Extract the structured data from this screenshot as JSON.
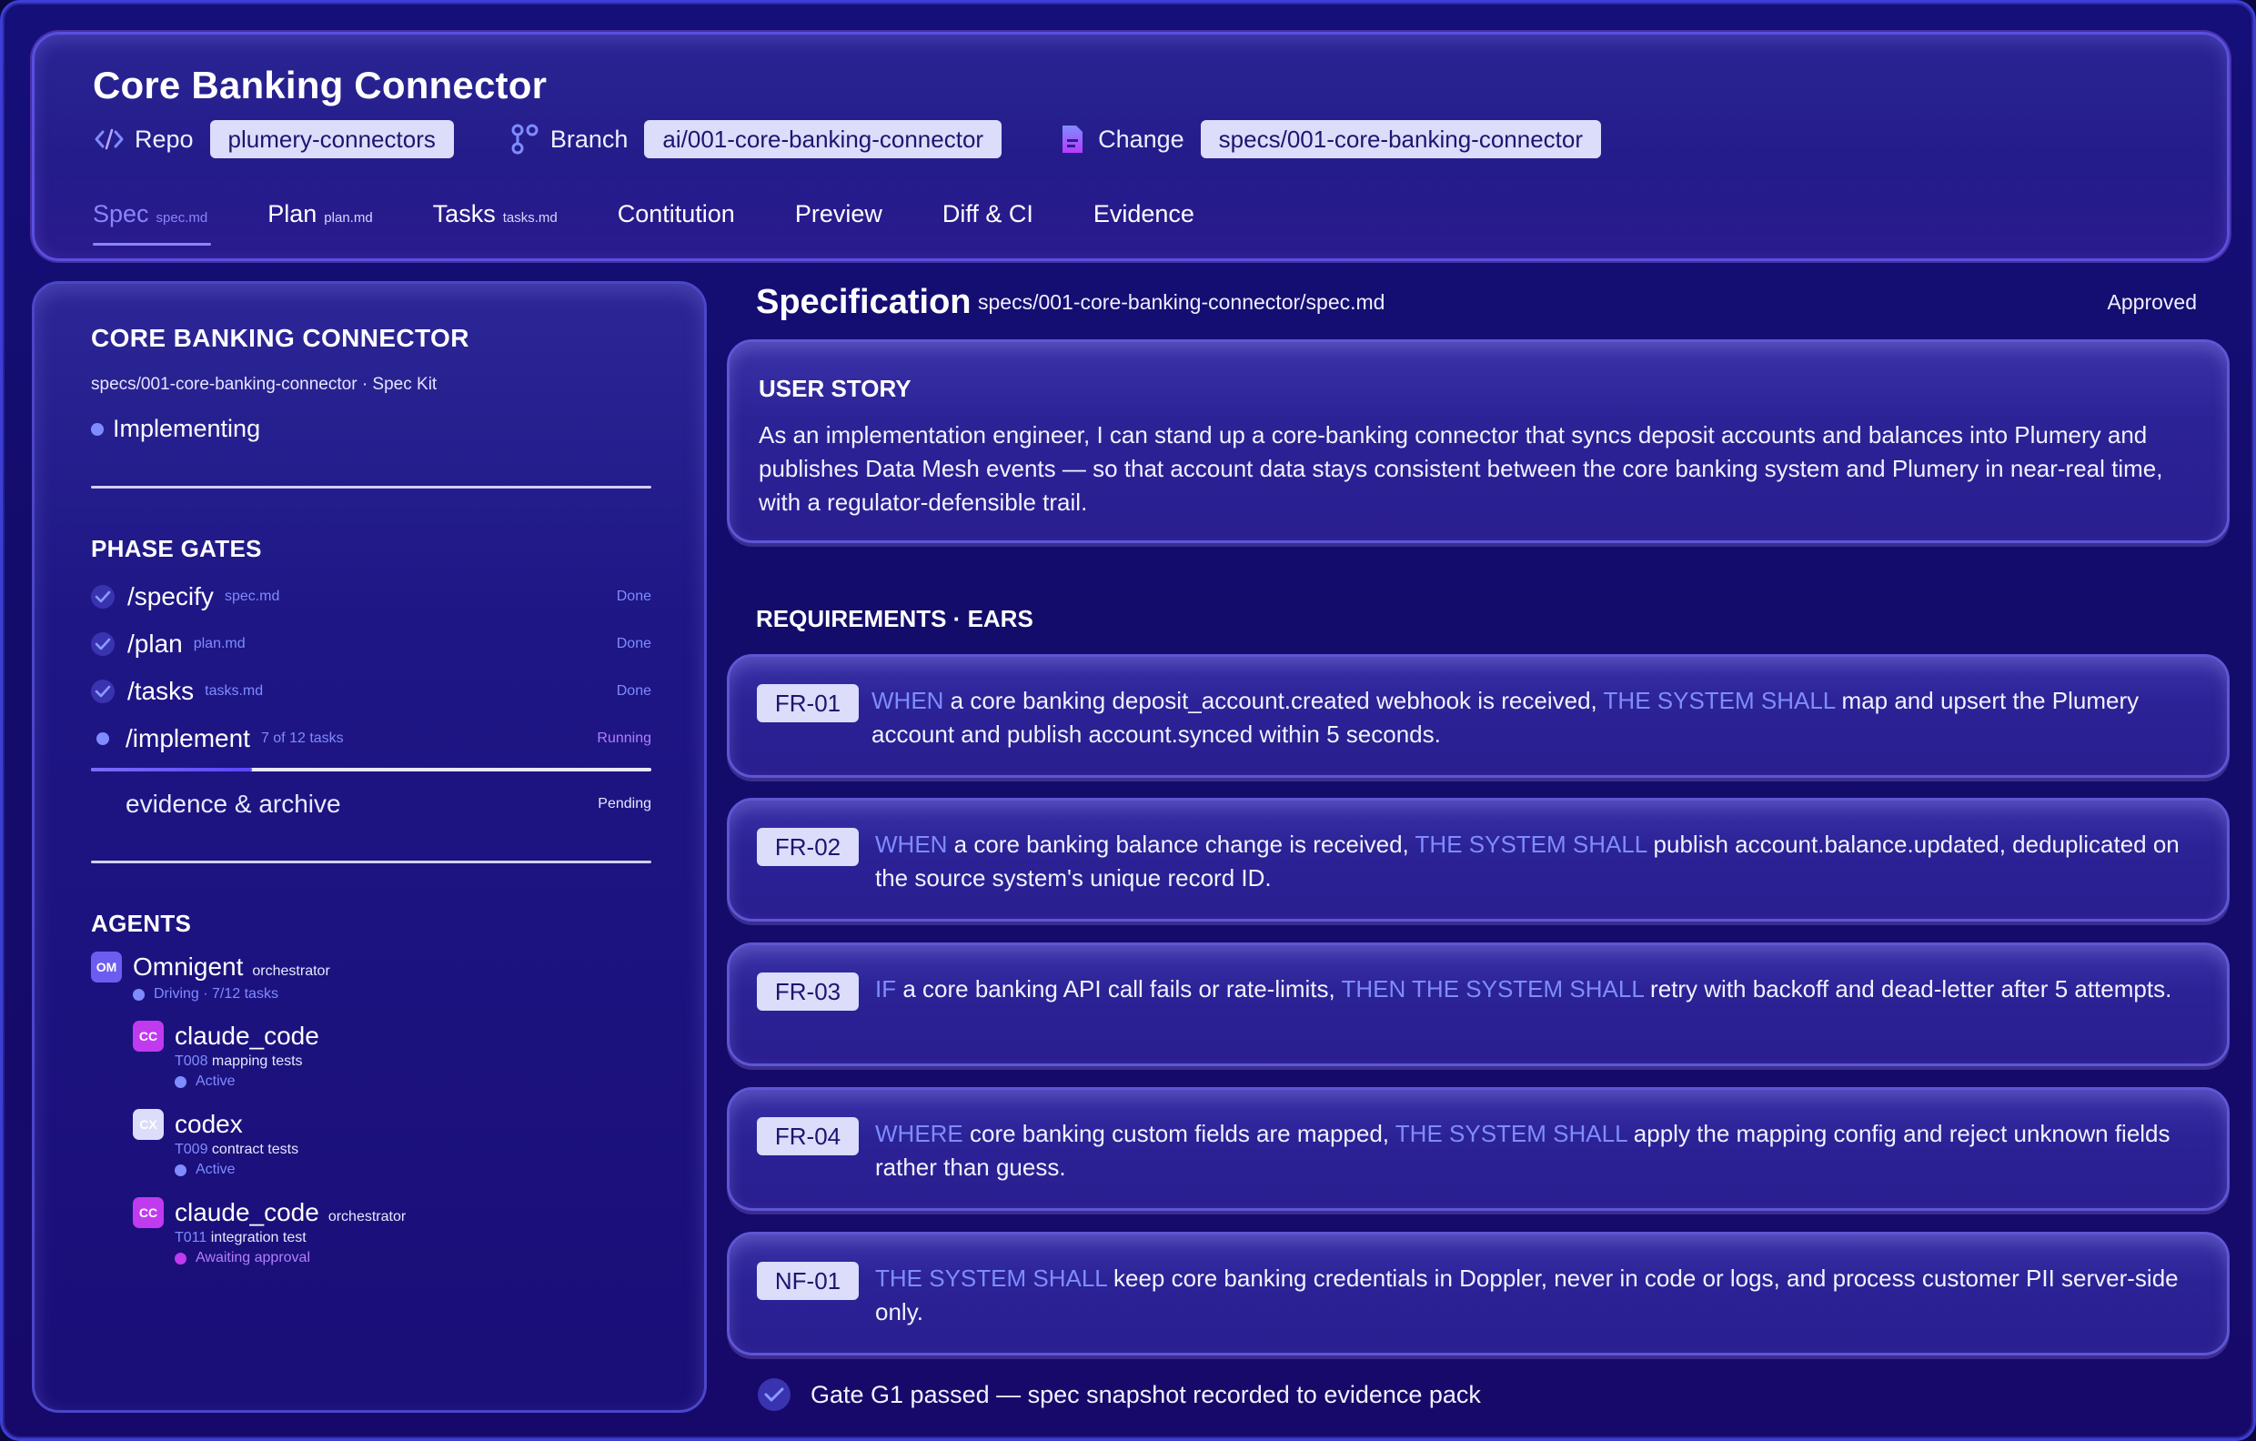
{
  "header": {
    "title": "Core Banking Connector",
    "repo": {
      "label": "Repo",
      "value": "plumery-connectors"
    },
    "branch": {
      "label": "Branch",
      "value": "ai/001-core-banking-connector"
    },
    "change": {
      "label": "Change",
      "value": "specs/001-core-banking-connector"
    },
    "tabs": [
      {
        "label": "Spec",
        "file": "spec.md"
      },
      {
        "label": "Plan",
        "file": "plan.md"
      },
      {
        "label": "Tasks",
        "file": "tasks.md"
      },
      {
        "label": "Contitution",
        "file": ""
      },
      {
        "label": "Preview",
        "file": ""
      },
      {
        "label": "Diff & CI",
        "file": ""
      },
      {
        "label": "Evidence",
        "file": ""
      }
    ],
    "active_tab": "Spec"
  },
  "sidebar": {
    "title": "CORE BANKING CONNECTOR",
    "subtitle": "specs/001-core-banking-connector · Spec Kit",
    "status": "Implementing",
    "phase_gates_title": "PHASE GATES",
    "gates": [
      {
        "name": "/specify",
        "file": "spec.md",
        "status": "Done"
      },
      {
        "name": "/plan",
        "file": "plan.md",
        "status": "Done"
      },
      {
        "name": "/tasks",
        "file": "tasks.md",
        "status": "Done"
      },
      {
        "name": "/implement",
        "file": "7 of 12 tasks",
        "status": "Running"
      },
      {
        "name": "evidence & archive",
        "file": "",
        "status": "Pending"
      }
    ],
    "implement_progress": 0.2875,
    "agents_title": "AGENTS",
    "agents": [
      {
        "initials": "OM",
        "name": "Omnigent",
        "role": "orchestrator",
        "task_id": "",
        "task": "",
        "state": "Driving · 7/12 tasks"
      },
      {
        "initials": "CC",
        "name": "claude_code",
        "role": "",
        "task_id": "T008",
        "task": "mapping tests",
        "state": "Active"
      },
      {
        "initials": "CX",
        "name": "codex",
        "role": "",
        "task_id": "T009",
        "task": "contract tests",
        "state": "Active"
      },
      {
        "initials": "CC",
        "name": "claude_code",
        "role": "orchestrator",
        "task_id": "T011",
        "task": "integration test",
        "state": "Awaiting approval"
      }
    ]
  },
  "main": {
    "title": "Specification",
    "path": "specs/001-core-banking-connector/spec.md",
    "status": "Approved",
    "user_story_title": "USER STORY",
    "user_story": "As an implementation engineer, I can stand up a core-banking connector that syncs deposit accounts and balances into Plumery and publishes Data Mesh events — so that account data stays consistent between the core banking system and Plumery in near-real time, with a regulator-defensible trail.",
    "requirements_title": "REQUIREMENTS · EARS",
    "requirements": [
      {
        "id": "FR-01",
        "kw1": "WHEN",
        "t1": " a core banking deposit_account.created webhook is received, ",
        "kw2": "THE SYSTEM SHALL",
        "t2": " map and upsert the Plumery account and publish account.synced within 5 seconds."
      },
      {
        "id": "FR-02",
        "kw1": "WHEN",
        "t1": " a core banking balance change is received, ",
        "kw2": "THE SYSTEM SHALL",
        "t2": " publish account.balance.updated, deduplicated on the source system's unique record ID."
      },
      {
        "id": "FR-03",
        "kw1": "IF",
        "t1": " a core banking API call fails or rate-limits, ",
        "kw2": "THEN THE SYSTEM SHALL",
        "t2": " retry with backoff and dead-letter after 5 attempts."
      },
      {
        "id": "FR-04",
        "kw1": "WHERE",
        "t1": " core banking custom fields are mapped, ",
        "kw2": "THE SYSTEM SHALL",
        "t2": " apply the mapping config and reject unknown fields rather than guess."
      },
      {
        "id": "NF-01",
        "kw1": "",
        "t1": "",
        "kw2": "THE SYSTEM SHALL",
        "t2": " keep core banking credentials in Doppler, never in code or logs, and process customer PII server-side only."
      }
    ],
    "gate_pass": "Gate G1 passed — spec snapshot recorded to evidence pack"
  },
  "colors": {
    "accent": "#7f8cff",
    "running": "#b27dff",
    "chip_bg": "#dcdcfb",
    "chip_text": "#1b1670",
    "avatar_om": "#6c5cf0",
    "avatar_cc": "#c03af0",
    "avatar_cx": "#dcdcfb"
  },
  "icons": {
    "repo": "code-icon",
    "branch": "branch-icon",
    "change": "file-icon",
    "gate_done": "check-circle-icon",
    "gate_pass": "check-circle-icon"
  }
}
